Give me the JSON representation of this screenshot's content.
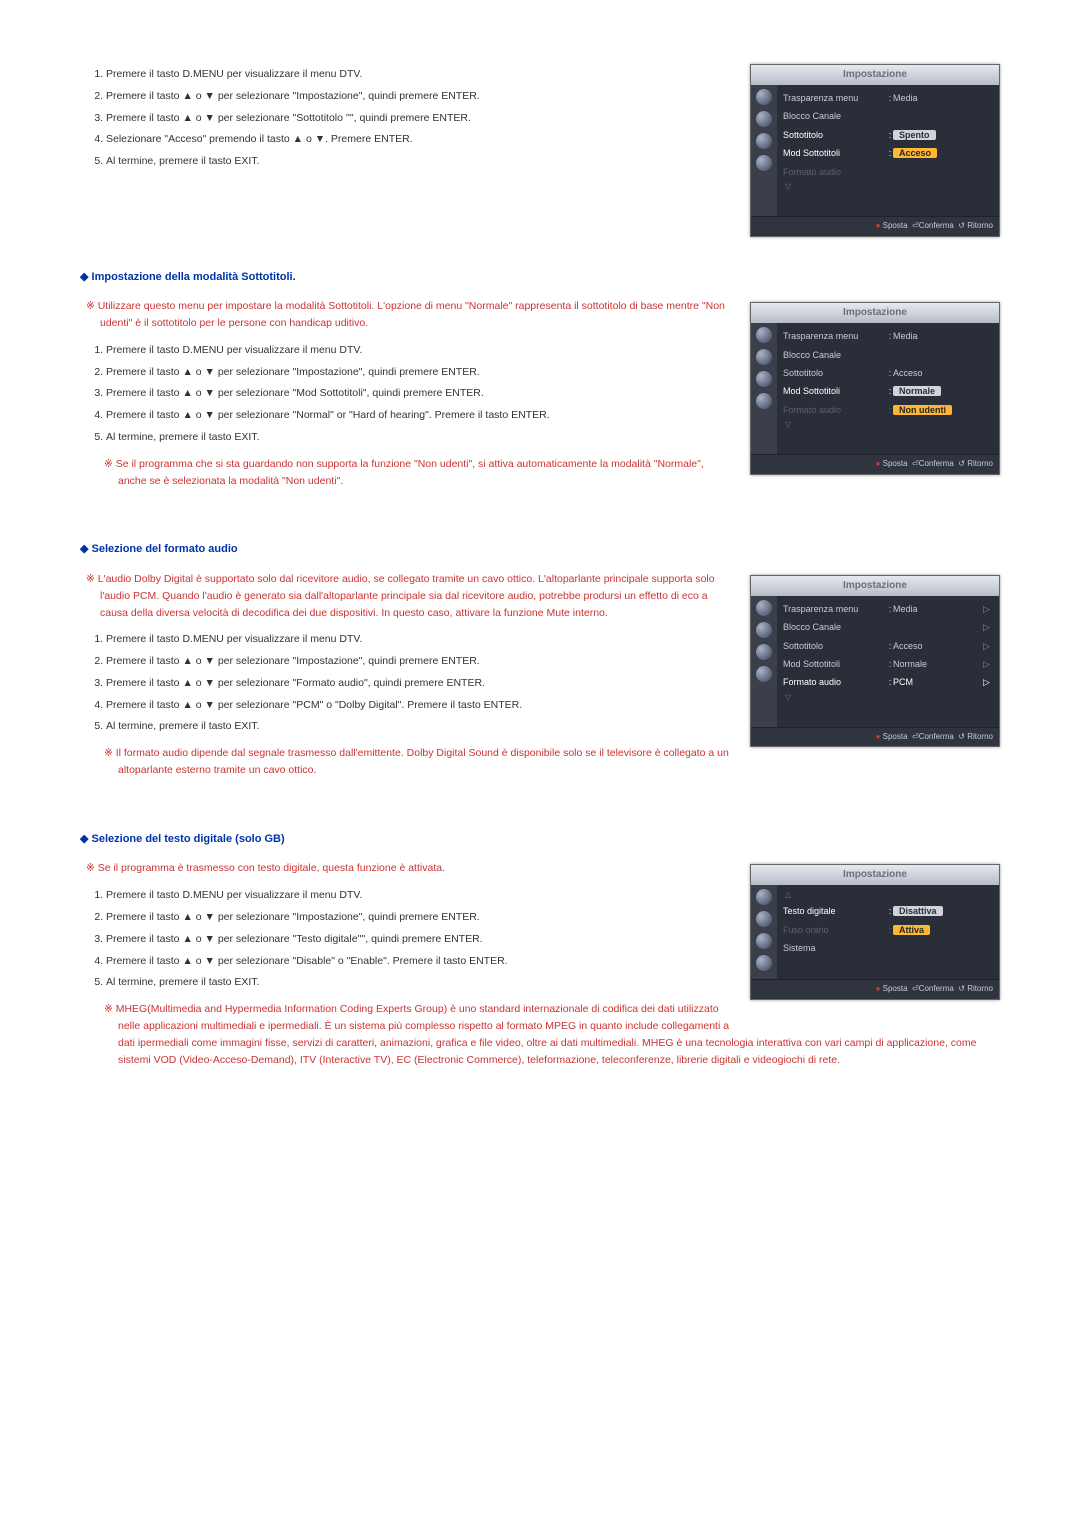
{
  "instructions": {
    "sottotitolo_steps": [
      "Premere il tasto D.MENU per visualizzare il menu DTV.",
      "Premere il tasto ▲ o ▼ per selezionare \"Impostazione\", quindi premere ENTER.",
      "Premere il tasto ▲ o ▼ per selezionare \"Sottotitolo ''\", quindi premere ENTER.",
      "Selezionare \"Acceso\" premendo il tasto ▲ o ▼. Premere ENTER.",
      "Al termine, premere il tasto EXIT."
    ],
    "mod_sottotitoli_heading": "Impostazione della modalità Sottotitoli.",
    "mod_sottotitoli_note": "Utilizzare questo menu per impostare la modalità Sottotitoli. L'opzione di menu \"Normale\" rappresenta il sottotitolo di base mentre \"Non udenti\" è il sottotitolo per le persone con handicap uditivo.",
    "mod_sottotitoli_steps": [
      "Premere il tasto D.MENU per visualizzare il menu DTV.",
      "Premere il tasto ▲ o ▼ per selezionare \"Impostazione\", quindi premere ENTER.",
      "Premere il tasto ▲ o ▼ per selezionare \"Mod Sottotitoli\", quindi premere ENTER.",
      "Premere il tasto ▲ o ▼ per selezionare \"Normal\" or \"Hard of hearing\". Premere il tasto ENTER.",
      "Al termine, premere il tasto EXIT."
    ],
    "mod_sottotitoli_note2": "Se il programma che si sta guardando non supporta la funzione \"Non udenti\", si attiva automaticamente la modalità \"Normale\", anche se è selezionata la modalità \"Non udenti\".",
    "formato_audio_heading": "Selezione del formato audio",
    "formato_audio_note": "L'audio Dolby Digital è supportato solo dal ricevitore audio, se collegato tramite un cavo ottico. L'altoparlante principale supporta solo l'audio PCM. Quando l'audio è generato sia dall'altoparlante principale sia dal ricevitore audio, potrebbe prodursi un effetto di eco a causa della diversa velocità di decodifica dei due dispositivi. In questo caso, attivare la funzione Mute interno.",
    "formato_audio_steps": [
      "Premere il tasto D.MENU per visualizzare il menu DTV.",
      "Premere il tasto ▲ o ▼ per selezionare \"Impostazione\", quindi premere ENTER.",
      "Premere il tasto ▲ o ▼ per selezionare \"Formato audio\", quindi premere ENTER.",
      "Premere il tasto ▲ o ▼ per selezionare \"PCM\" o \"Dolby Digital\". Premere il tasto ENTER.",
      "Al termine, premere il tasto EXIT."
    ],
    "formato_audio_note2": "Il formato audio dipende dal segnale trasmesso dall'emittente. Dolby Digital Sound è disponibile solo se il televisore è collegato a un altoparlante esterno tramite un cavo ottico.",
    "testo_digitale_heading": "Selezione del testo digitale (solo GB)",
    "testo_digitale_note": "Se il programma è trasmesso con testo digitale, questa funzione è attivata.",
    "testo_digitale_steps": [
      "Premere il tasto D.MENU per visualizzare il menu DTV.",
      "Premere il tasto ▲ o ▼ per selezionare \"Impostazione\", quindi premere ENTER.",
      "Premere il tasto ▲ o ▼ per selezionare \"Testo digitale''\", quindi premere ENTER.",
      "Premere il tasto ▲ o ▼ per selezionare \"Disable\" o \"Enable\". Premere il tasto ENTER.",
      "Al termine, premere il tasto EXIT."
    ],
    "testo_digitale_note2": "MHEG(Multimedia and Hypermedia Information Coding Experts Group) è uno standard internazionale di codifica dei dati utilizzato nelle applicazioni multimediali e ipermediali. È un sistema più complesso rispetto al formato MPEG in quanto include collegamenti a dati ipermediali come immagini fisse, servizi di caratteri, animazioni, grafica e file video, oltre ai dati multimediali. MHEG è una tecnologia interattiva con vari campi di applicazione, come sistemi VOD (Video-Acceso-Demand), ITV (Interactive TV), EC (Electronic Commerce), teleformazione, teleconferenze, librerie digitali e videogiochi di rete."
  },
  "osd": {
    "title": "Impostazione",
    "footer_sposta": "Sposta",
    "footer_conferma": "Conferma",
    "footer_ritorno": "Ritorno",
    "labels": {
      "trasparenza": "Trasparenza menu",
      "blocco": "Blocco Canale",
      "sottotitolo": "Sottotitolo",
      "mod_sotto": "Mod Sottotitoli",
      "formato_audio": "Formato audio",
      "testo_digitale": "Testo digitale",
      "fuso": "Fuso orario",
      "sistema": "Sistema"
    },
    "vals": {
      "media": "Media",
      "spento": "Spento",
      "acceso": "Acceso",
      "normale": "Normale",
      "non_udenti": "Non udenti",
      "pcm": "PCM",
      "disattiva": "Disattiva",
      "attiva": "Attiva"
    }
  }
}
